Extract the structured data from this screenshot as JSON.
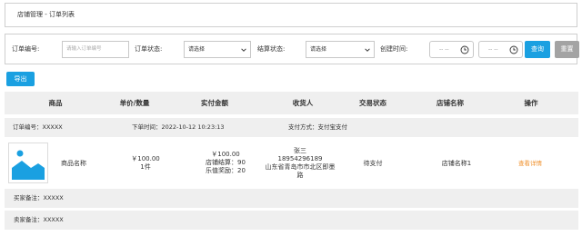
{
  "breadcrumb": "店铺管理 - 订单列表",
  "filter": {
    "order_no_label": "订单编号:",
    "order_no_placeholder": "请输入订单编号",
    "order_status_label": "订单状态:",
    "order_status_value": "请选择",
    "settle_status_label": "结算状态:",
    "settle_status_value": "请选择",
    "created_time_label": "创建时间:",
    "date_start_placeholder": "-- --",
    "date_end_placeholder": "-- --",
    "query_label": "查询",
    "reset_label": "重置"
  },
  "export_label": "导出",
  "table": {
    "headers": [
      "商品",
      "单价/数量",
      "实付金额",
      "收货人",
      "交易状态",
      "店铺名称",
      "操作"
    ]
  },
  "order": {
    "order_no": "订单编号：XXXXX",
    "order_time": "下单时间：2022-10-12 10:23:13",
    "pay_method": "支付方式：支付宝支付",
    "product_name": "商品名称",
    "unit_price": "￥100.00",
    "quantity": "1件",
    "paid_amount": "￥100.00",
    "store_settle": "店铺结算：90",
    "reward": "乐值奖励：20",
    "receiver_name": "张三",
    "receiver_phone": "18954296189",
    "receiver_addr_1": "山东省青岛市市北区即墨",
    "receiver_addr_2": "路",
    "status": "待支付",
    "store_name": "店铺名称1",
    "action_label": "查看详情",
    "buyer_remark": "买家备注：XXXXX",
    "seller_remark": "卖家备注：XXXXX"
  },
  "colors": {
    "primary": "#1aa0e1",
    "reset": "#a3a3a3",
    "link": "#f0922e",
    "header_bg": "#efefef"
  }
}
